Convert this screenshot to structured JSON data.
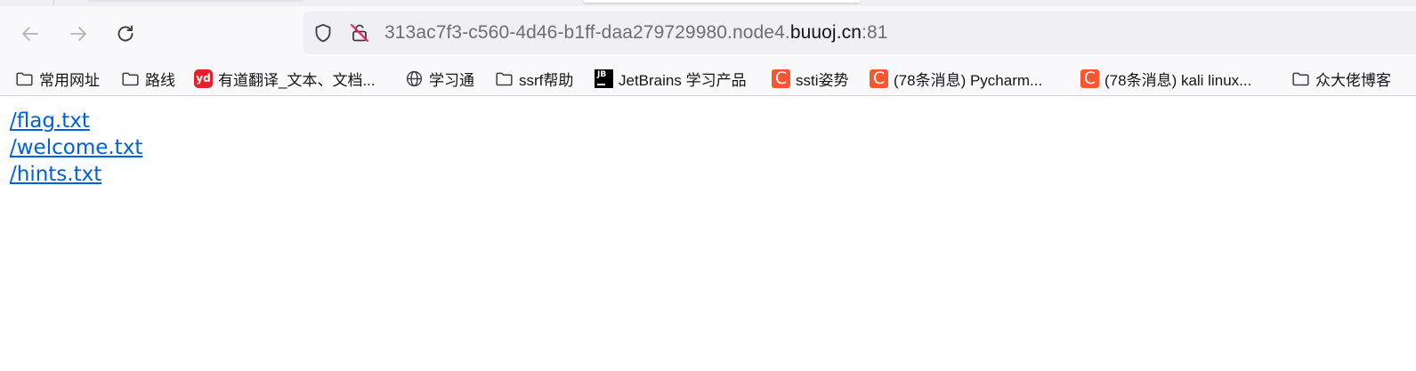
{
  "browser": {
    "url": {
      "prefix": "313ac7f3-c560-4d46-b1ff-daa279729980.node4.",
      "host": "buuoj.cn",
      "port": ":81"
    },
    "nav_icons": {
      "back": "arrow-left-icon",
      "forward": "arrow-right-icon",
      "reload": "reload-icon"
    }
  },
  "bookmarks": [
    {
      "label": "常用网址",
      "icon": "folder-icon"
    },
    {
      "label": "路线",
      "icon": "folder-icon"
    },
    {
      "label": "有道翻译_文本、文档...",
      "icon": "youdao-icon",
      "icon_text": "yd"
    },
    {
      "label": "学习通",
      "icon": "globe-icon"
    },
    {
      "label": "ssrf帮助",
      "icon": "folder-icon"
    },
    {
      "label": "JetBrains 学习产品",
      "icon": "jetbrains-icon",
      "icon_text": "JB"
    },
    {
      "label": "ssti姿势",
      "icon": "csdn-icon",
      "icon_text": "C"
    },
    {
      "label": "(78条消息) Pycharm...",
      "icon": "csdn-icon",
      "icon_text": "C"
    },
    {
      "label": "(78条消息) kali linux...",
      "icon": "csdn-icon",
      "icon_text": "C"
    },
    {
      "label": "众大佬博客",
      "icon": "folder-icon"
    }
  ],
  "page": {
    "links": [
      "/flag.txt",
      "/welcome.txt",
      "/hints.txt"
    ]
  },
  "colors": {
    "link": "#0060df",
    "toolbar": "#f9f9fb",
    "urlbar": "#f0f0f4",
    "csdn": "#fc5531",
    "youdao": "#e2232c"
  }
}
